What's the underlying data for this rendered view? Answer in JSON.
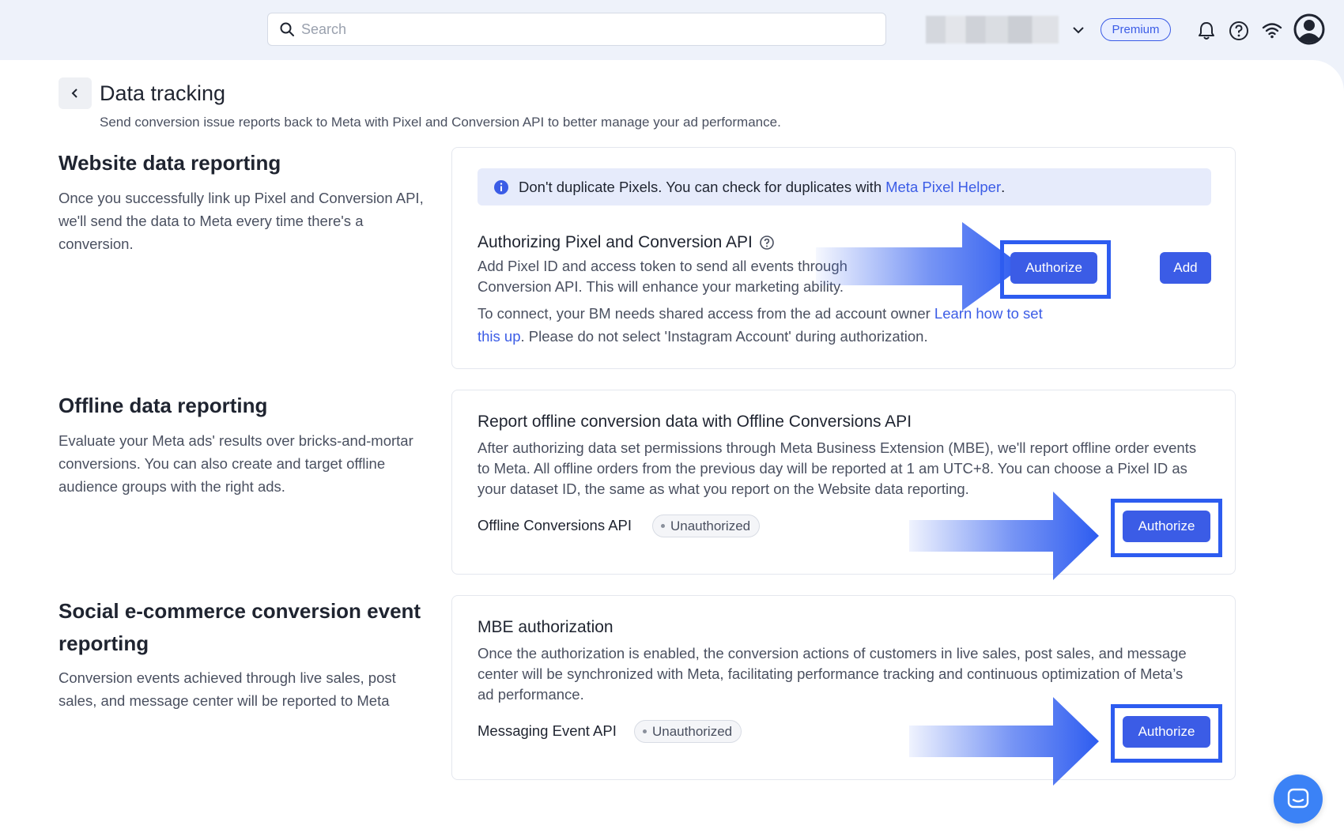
{
  "search": {
    "placeholder": "Search"
  },
  "topbar": {
    "premium_label": "Premium"
  },
  "page": {
    "title": "Data tracking",
    "subtitle": "Send conversion issue reports back to Meta with Pixel and Conversion API to better manage your ad performance."
  },
  "sections": {
    "website": {
      "title": "Website data reporting",
      "desc": "Once you successfully link up Pixel and Conversion API, we'll send the data to Meta every time there's a conversion.",
      "info_text": "Don't duplicate Pixels. You can check for duplicates with ",
      "info_link": "Meta Pixel Helper",
      "info_end": ".",
      "card_title": "Authorizing Pixel and Conversion API",
      "card_text_1": "Add Pixel ID and access token to send all events through Conversion API. This will enhance your marketing ability.",
      "card_text_2a": "To connect, your BM needs shared access from the ad account owner ",
      "card_text_2_link": "Learn how to set this up",
      "card_text_2b": ". Please do not select 'Instagram Account' during authorization.",
      "authorize_label": "Authorize",
      "add_label": "Add"
    },
    "offline": {
      "title": "Offline data reporting",
      "desc": "Evaluate your Meta ads' results over bricks-and-mortar conversions. You can also create and target offline audience groups with the right ads.",
      "card_title": "Report offline conversion data with Offline Conversions API",
      "card_text": "After authorizing data set permissions through Meta Business Extension (MBE), we'll report offline order events to Meta. All offline orders from the previous day will be reported at 1 am UTC+8. You can choose a Pixel ID as your dataset ID, the same as what you report on the Website data reporting.",
      "status_label": "Offline Conversions API",
      "status_badge": "Unauthorized",
      "authorize_label": "Authorize"
    },
    "social": {
      "title": "Social e-commerce conversion event reporting",
      "desc": "Conversion events achieved through live sales, post sales, and message center will be reported to Meta",
      "card_title": "MBE authorization",
      "card_text": "Once the authorization is enabled, the conversion actions of customers in live sales, post sales, and message center will be synchronized with Meta, facilitating performance tracking and continuous optimization of Meta’s ad performance.",
      "status_label": "Messaging Event API",
      "status_badge": "Unauthorized",
      "authorize_label": "Authorize"
    }
  },
  "colors": {
    "accent": "#3b5ce6",
    "highlight": "#2d5cf0",
    "background": "#eef2fa"
  },
  "icons": [
    "search-icon",
    "chevron-down-icon",
    "bell-icon",
    "help-icon",
    "wifi-icon",
    "avatar-icon",
    "back-chevron-icon",
    "info-icon",
    "question-circle-icon",
    "chat-icon",
    "arrow-pointer"
  ]
}
